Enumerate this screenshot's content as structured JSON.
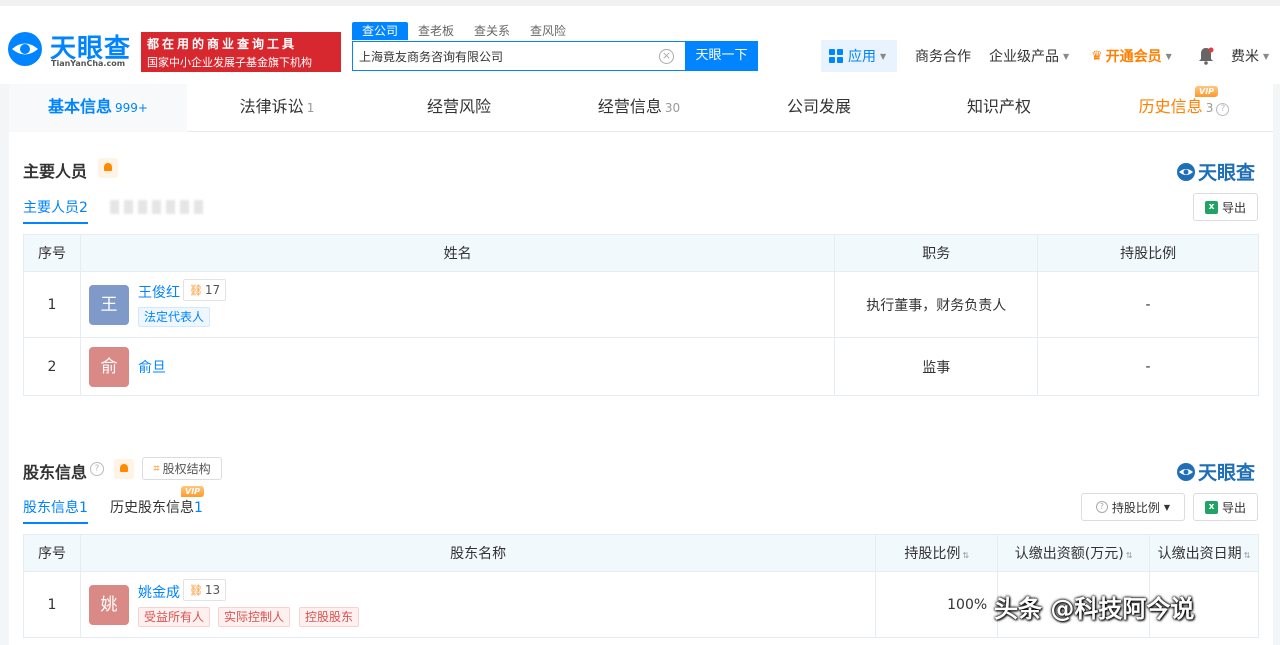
{
  "header": {
    "logo_text": "天眼查",
    "logo_sub": "TianYanCha.com",
    "slogan_line1": "都在用的商业查询工具",
    "slogan_line2": "国家中小企业发展子基金旗下机构",
    "search_tabs": [
      "查公司",
      "查老板",
      "查关系",
      "查风险"
    ],
    "search_value": "上海竟友商务咨询有限公司",
    "search_button": "天眼一下",
    "app_label": "应用",
    "business_label": "商务合作",
    "enterprise_label": "企业级产品",
    "vip_label": "开通会员",
    "user_label": "费米"
  },
  "tabs": [
    {
      "label": "基本信息",
      "count": "999+"
    },
    {
      "label": "法律诉讼",
      "count": "1"
    },
    {
      "label": "经营风险",
      "count": ""
    },
    {
      "label": "经营信息",
      "count": "30"
    },
    {
      "label": "公司发展",
      "count": ""
    },
    {
      "label": "知识产权",
      "count": ""
    },
    {
      "label": "历史信息",
      "count": "3"
    }
  ],
  "vip_text": "VIP",
  "watermark_logo": "天眼查",
  "personnel": {
    "title": "主要人员",
    "subtab_label": "主要人员",
    "subtab_count": "2",
    "export_label": "导出",
    "columns": [
      "序号",
      "姓名",
      "职务",
      "持股比例"
    ],
    "rows": [
      {
        "no": "1",
        "avatar": "王",
        "name": "王俊红",
        "rel_count": "17",
        "tag": "法定代表人",
        "position": "执行董事，财务负责人",
        "ratio": "-"
      },
      {
        "no": "2",
        "avatar": "俞",
        "name": "俞旦",
        "rel_count": "",
        "tag": "",
        "position": "监事",
        "ratio": "-"
      }
    ]
  },
  "shareholders": {
    "title": "股东信息",
    "equity_button": "股权结构",
    "subtab_label": "股东信息",
    "subtab_count": "1",
    "history_label": "历史股东信息",
    "history_count": "1",
    "filter_label": "持股比例",
    "export_label": "导出",
    "columns": [
      "序号",
      "股东名称",
      "持股比例",
      "认缴出资额(万元)",
      "认缴出资日期"
    ],
    "rows": [
      {
        "no": "1",
        "avatar": "姚",
        "name": "姚金成",
        "rel_count": "13",
        "tags": [
          "受益所有人",
          "实际控制人",
          "控股股东"
        ],
        "ratio": "100%"
      }
    ]
  },
  "overlay_watermark": "头条 @科技阿今说",
  "colors": {
    "brand": "#0084ff",
    "vip": "#ff7f00",
    "slogan_bg": "#d7282f"
  }
}
